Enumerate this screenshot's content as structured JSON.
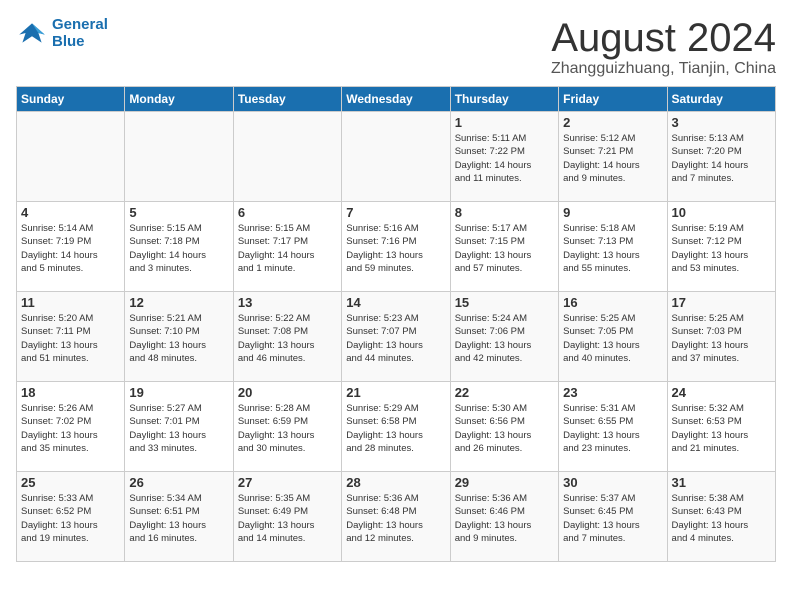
{
  "logo": {
    "line1": "General",
    "line2": "Blue"
  },
  "title": "August 2024",
  "location": "Zhangguizhuang, Tianjin, China",
  "weekdays": [
    "Sunday",
    "Monday",
    "Tuesday",
    "Wednesday",
    "Thursday",
    "Friday",
    "Saturday"
  ],
  "weeks": [
    [
      {
        "day": "",
        "info": ""
      },
      {
        "day": "",
        "info": ""
      },
      {
        "day": "",
        "info": ""
      },
      {
        "day": "",
        "info": ""
      },
      {
        "day": "1",
        "info": "Sunrise: 5:11 AM\nSunset: 7:22 PM\nDaylight: 14 hours\nand 11 minutes."
      },
      {
        "day": "2",
        "info": "Sunrise: 5:12 AM\nSunset: 7:21 PM\nDaylight: 14 hours\nand 9 minutes."
      },
      {
        "day": "3",
        "info": "Sunrise: 5:13 AM\nSunset: 7:20 PM\nDaylight: 14 hours\nand 7 minutes."
      }
    ],
    [
      {
        "day": "4",
        "info": "Sunrise: 5:14 AM\nSunset: 7:19 PM\nDaylight: 14 hours\nand 5 minutes."
      },
      {
        "day": "5",
        "info": "Sunrise: 5:15 AM\nSunset: 7:18 PM\nDaylight: 14 hours\nand 3 minutes."
      },
      {
        "day": "6",
        "info": "Sunrise: 5:15 AM\nSunset: 7:17 PM\nDaylight: 14 hours\nand 1 minute."
      },
      {
        "day": "7",
        "info": "Sunrise: 5:16 AM\nSunset: 7:16 PM\nDaylight: 13 hours\nand 59 minutes."
      },
      {
        "day": "8",
        "info": "Sunrise: 5:17 AM\nSunset: 7:15 PM\nDaylight: 13 hours\nand 57 minutes."
      },
      {
        "day": "9",
        "info": "Sunrise: 5:18 AM\nSunset: 7:13 PM\nDaylight: 13 hours\nand 55 minutes."
      },
      {
        "day": "10",
        "info": "Sunrise: 5:19 AM\nSunset: 7:12 PM\nDaylight: 13 hours\nand 53 minutes."
      }
    ],
    [
      {
        "day": "11",
        "info": "Sunrise: 5:20 AM\nSunset: 7:11 PM\nDaylight: 13 hours\nand 51 minutes."
      },
      {
        "day": "12",
        "info": "Sunrise: 5:21 AM\nSunset: 7:10 PM\nDaylight: 13 hours\nand 48 minutes."
      },
      {
        "day": "13",
        "info": "Sunrise: 5:22 AM\nSunset: 7:08 PM\nDaylight: 13 hours\nand 46 minutes."
      },
      {
        "day": "14",
        "info": "Sunrise: 5:23 AM\nSunset: 7:07 PM\nDaylight: 13 hours\nand 44 minutes."
      },
      {
        "day": "15",
        "info": "Sunrise: 5:24 AM\nSunset: 7:06 PM\nDaylight: 13 hours\nand 42 minutes."
      },
      {
        "day": "16",
        "info": "Sunrise: 5:25 AM\nSunset: 7:05 PM\nDaylight: 13 hours\nand 40 minutes."
      },
      {
        "day": "17",
        "info": "Sunrise: 5:25 AM\nSunset: 7:03 PM\nDaylight: 13 hours\nand 37 minutes."
      }
    ],
    [
      {
        "day": "18",
        "info": "Sunrise: 5:26 AM\nSunset: 7:02 PM\nDaylight: 13 hours\nand 35 minutes."
      },
      {
        "day": "19",
        "info": "Sunrise: 5:27 AM\nSunset: 7:01 PM\nDaylight: 13 hours\nand 33 minutes."
      },
      {
        "day": "20",
        "info": "Sunrise: 5:28 AM\nSunset: 6:59 PM\nDaylight: 13 hours\nand 30 minutes."
      },
      {
        "day": "21",
        "info": "Sunrise: 5:29 AM\nSunset: 6:58 PM\nDaylight: 13 hours\nand 28 minutes."
      },
      {
        "day": "22",
        "info": "Sunrise: 5:30 AM\nSunset: 6:56 PM\nDaylight: 13 hours\nand 26 minutes."
      },
      {
        "day": "23",
        "info": "Sunrise: 5:31 AM\nSunset: 6:55 PM\nDaylight: 13 hours\nand 23 minutes."
      },
      {
        "day": "24",
        "info": "Sunrise: 5:32 AM\nSunset: 6:53 PM\nDaylight: 13 hours\nand 21 minutes."
      }
    ],
    [
      {
        "day": "25",
        "info": "Sunrise: 5:33 AM\nSunset: 6:52 PM\nDaylight: 13 hours\nand 19 minutes."
      },
      {
        "day": "26",
        "info": "Sunrise: 5:34 AM\nSunset: 6:51 PM\nDaylight: 13 hours\nand 16 minutes."
      },
      {
        "day": "27",
        "info": "Sunrise: 5:35 AM\nSunset: 6:49 PM\nDaylight: 13 hours\nand 14 minutes."
      },
      {
        "day": "28",
        "info": "Sunrise: 5:36 AM\nSunset: 6:48 PM\nDaylight: 13 hours\nand 12 minutes."
      },
      {
        "day": "29",
        "info": "Sunrise: 5:36 AM\nSunset: 6:46 PM\nDaylight: 13 hours\nand 9 minutes."
      },
      {
        "day": "30",
        "info": "Sunrise: 5:37 AM\nSunset: 6:45 PM\nDaylight: 13 hours\nand 7 minutes."
      },
      {
        "day": "31",
        "info": "Sunrise: 5:38 AM\nSunset: 6:43 PM\nDaylight: 13 hours\nand 4 minutes."
      }
    ]
  ]
}
